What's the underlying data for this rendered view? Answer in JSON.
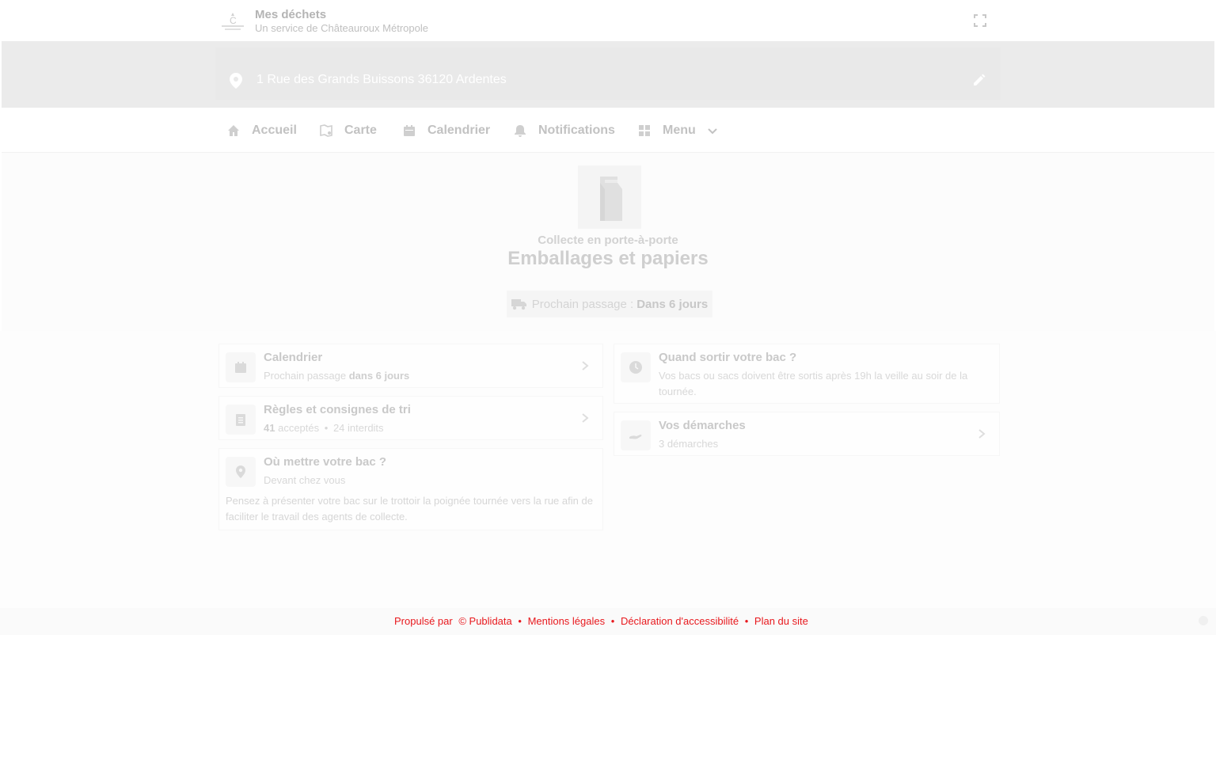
{
  "header": {
    "title": "Mes déchets",
    "subtitle": "Un service de Châteauroux Métropole"
  },
  "address": {
    "text": "1 Rue des Grands Buissons 36120 Ardentes"
  },
  "nav": {
    "items": [
      {
        "label": "Accueil",
        "icon": "home-icon"
      },
      {
        "label": "Carte",
        "icon": "map-icon"
      },
      {
        "label": "Calendrier",
        "icon": "calendar-icon"
      },
      {
        "label": "Notifications",
        "icon": "bell-icon"
      },
      {
        "label": "Menu",
        "icon": "grid-icon"
      }
    ]
  },
  "hero": {
    "category": "Collecte en porte-à-porte",
    "title": "Emballages et papiers",
    "next_prefix": "Prochain passage :",
    "next_value": "Dans 6 jours"
  },
  "cards": {
    "calendar": {
      "title": "Calendrier",
      "sub_prefix": "Prochain passage",
      "sub_value": "dans 6 jours"
    },
    "rules": {
      "title": "Règles et consignes de tri",
      "accepted_count": "41",
      "accepted_label": "acceptés",
      "separator": "•",
      "forbidden": "24 interdits"
    },
    "where": {
      "title": "Où mettre votre bac ?",
      "sub": "Devant chez vous",
      "body": "Pensez à présenter votre bac sur le trottoir la poignée tournée vers la rue afin de faciliter le travail des agents de collecte."
    },
    "when": {
      "title": "Quand sortir votre bac ?",
      "sub": "Vos bacs ou sacs doivent être sortis après 19h la veille au soir de la tournée."
    },
    "procedures": {
      "title": "Vos démarches",
      "sub": "3 démarches"
    }
  },
  "footer": {
    "links": [
      "Propulsé par",
      "© Publidata",
      "•",
      "Mentions légales",
      "•",
      "Déclaration d'accessibilité",
      "•",
      "Plan du site"
    ]
  },
  "colors": {
    "footer_link": "#e8191e"
  }
}
